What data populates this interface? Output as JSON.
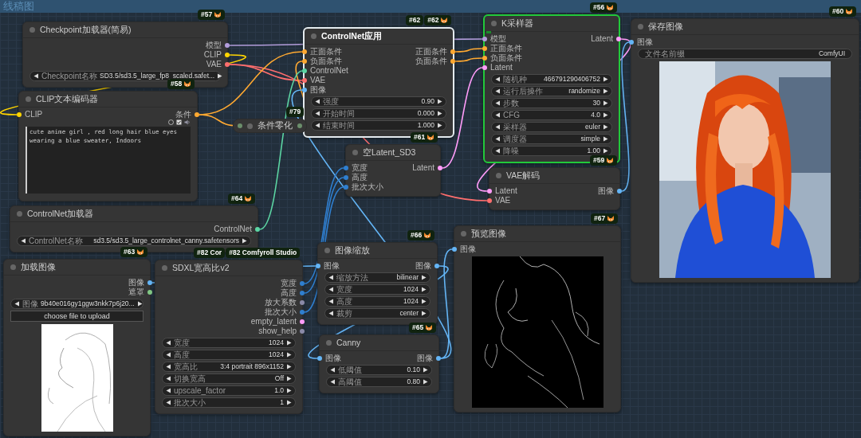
{
  "group": {
    "title": "线稿图"
  },
  "nodes": [
    {
      "kind": "node",
      "title": "Checkpoint加载器(简易)",
      "selected": false,
      "running": false,
      "badges": [
        {
          "text": "#57",
          "fox": true
        }
      ],
      "outputs": [
        {
          "label": "模型",
          "color": "#b39ddb"
        },
        {
          "label": "CLIP",
          "color": "#ffd500"
        },
        {
          "label": "VAE",
          "color": "#ff6e6e"
        }
      ],
      "widgets": [
        {
          "label": "Checkpoint名称",
          "value": "SD3.5/sd3.5_large_fp8_scaled.safet..."
        }
      ]
    },
    {
      "kind": "node",
      "title": "ControlNet应用",
      "selected": true,
      "running": false,
      "badges": [
        {
          "text": "#62",
          "fox": false
        },
        {
          "text": "#62",
          "fox": true
        }
      ],
      "inputs": [
        {
          "label": "正面条件",
          "color": "#ffa931"
        },
        {
          "label": "负面条件",
          "color": "#ffa931"
        },
        {
          "label": "ControlNet",
          "color": "#5cd6a4"
        },
        {
          "label": "VAE",
          "color": "#ff6e6e"
        },
        {
          "label": "图像",
          "color": "#64b5f6"
        }
      ],
      "outputs": [
        {
          "label": "正面条件",
          "color": "#ffa931"
        },
        {
          "label": "负面条件",
          "color": "#ffa931"
        }
      ],
      "widgets": [
        {
          "label": "强度",
          "value": "0.90"
        },
        {
          "label": "开始时间",
          "value": "0.000"
        },
        {
          "label": "结束时间",
          "value": "1.000"
        }
      ]
    },
    {
      "kind": "node",
      "title": "K采样器",
      "selected": false,
      "running": true,
      "badges": [
        {
          "text": "#56",
          "fox": true
        }
      ],
      "inputs": [
        {
          "label": "模型",
          "color": "#b39ddb"
        },
        {
          "label": "正面条件",
          "color": "#ffa931"
        },
        {
          "label": "负面条件",
          "color": "#ffa931"
        },
        {
          "label": "Latent",
          "color": "#ff9cf9"
        }
      ],
      "outputs": [
        {
          "label": "Latent",
          "color": "#ff9cf9"
        }
      ],
      "widgets": [
        {
          "label": "随机种",
          "value": "466791290406752"
        },
        {
          "label": "运行后操作",
          "value": "randomize"
        },
        {
          "label": "步数",
          "value": "30"
        },
        {
          "label": "CFG",
          "value": "4.0"
        },
        {
          "label": "采样器",
          "value": "euler"
        },
        {
          "label": "调度器",
          "value": "simple"
        },
        {
          "label": "降噪",
          "value": "1.00"
        }
      ]
    },
    {
      "kind": "node",
      "title": "保存图像",
      "selected": false,
      "running": false,
      "badges": [
        {
          "text": "#60",
          "fox": true
        }
      ],
      "inputs": [
        {
          "label": "图像",
          "color": "#64b5f6"
        }
      ],
      "text_widgets": [
        {
          "label": "文件名前缀",
          "value": "ComfyUI"
        }
      ],
      "image": {
        "kind": "picture"
      }
    },
    {
      "kind": "node",
      "title": "CLIP文本编码器",
      "selected": false,
      "running": false,
      "badges": [
        {
          "text": "#58",
          "fox": true
        }
      ],
      "inputs": [
        {
          "label": "CLIP",
          "color": "#ffd500"
        }
      ],
      "outputs": [
        {
          "label": "条件",
          "color": "#ffa931"
        }
      ],
      "prompt": "cute anime girl , red long hair blue eyes wearing a blue sweater, Indoors"
    },
    {
      "kind": "collapsed",
      "title": "条件零化",
      "selected": false,
      "running": false,
      "badges": [
        {
          "text": "#79",
          "fox": false
        }
      ]
    },
    {
      "kind": "node",
      "title": "空Latent_SD3",
      "selected": false,
      "running": false,
      "badges": [
        {
          "text": "#61",
          "fox": true
        }
      ],
      "inputs": [
        {
          "label": "宽度",
          "color": "#2f7fd0"
        },
        {
          "label": "高度",
          "color": "#2f7fd0"
        },
        {
          "label": "批次大小",
          "color": "#2f7fd0"
        }
      ],
      "outputs": [
        {
          "label": "Latent",
          "color": "#ff9cf9"
        }
      ]
    },
    {
      "kind": "node",
      "title": "VAE解码",
      "selected": false,
      "running": false,
      "badges": [
        {
          "text": "#59",
          "fox": true
        }
      ],
      "inputs": [
        {
          "label": "Latent",
          "color": "#ff9cf9"
        },
        {
          "label": "VAE",
          "color": "#ff6e6e"
        }
      ],
      "outputs": [
        {
          "label": "图像",
          "color": "#64b5f6"
        }
      ]
    },
    {
      "kind": "node",
      "title": "ControlNet加载器",
      "selected": false,
      "running": false,
      "badges": [
        {
          "text": "#64",
          "fox": true
        }
      ],
      "outputs": [
        {
          "label": "ControlNet",
          "color": "#5cd6a4"
        }
      ],
      "widgets": [
        {
          "label": "ControlNet名称",
          "value": "sd3.5/sd3.5_large_controlnet_canny.safetensors"
        }
      ]
    },
    {
      "kind": "node",
      "title": "加载图像",
      "selected": false,
      "running": false,
      "badges": [
        {
          "text": "#63",
          "fox": true
        }
      ],
      "outputs": [
        {
          "label": "图像",
          "color": "#64b5f6"
        },
        {
          "label": "遮罩",
          "color": "#81c784"
        }
      ],
      "widgets": [
        {
          "label": "图像",
          "value": "9b40e016gy1ggw3nkk7p6j20..."
        }
      ],
      "upload_button": "choose file to upload",
      "image": {
        "kind": "picture"
      }
    },
    {
      "kind": "node",
      "title": "SDXL宽高比v2",
      "selected": false,
      "running": false,
      "badges": [
        {
          "text": "#82 Cor",
          "fox": false
        },
        {
          "text": "#82 Comfyroll Studio",
          "fox": false
        }
      ],
      "outputs": [
        {
          "label": "宽度",
          "color": "#2f7fd0"
        },
        {
          "label": "高度",
          "color": "#2f7fd0"
        },
        {
          "label": "放大系数",
          "color": "#8a8aa8"
        },
        {
          "label": "批次大小",
          "color": "#2f7fd0"
        },
        {
          "label": "empty_latent",
          "color": "#ff9cf9"
        },
        {
          "label": "show_help",
          "color": "#8a8aa8"
        }
      ],
      "widgets": [
        {
          "label": "宽度",
          "value": "1024"
        },
        {
          "label": "高度",
          "value": "1024"
        },
        {
          "label": "宽高比",
          "value": "3:4 portrait 896x1152"
        },
        {
          "label": "切换宽高",
          "value": "Off"
        },
        {
          "label": "upscale_factor",
          "value": "1.0"
        },
        {
          "label": "批次大小",
          "value": "1"
        }
      ]
    },
    {
      "kind": "node",
      "title": "图像缩放",
      "selected": false,
      "running": false,
      "badges": [
        {
          "text": "#66",
          "fox": true
        }
      ],
      "inputs": [
        {
          "label": "图像",
          "color": "#64b5f6"
        }
      ],
      "outputs": [
        {
          "label": "图像",
          "color": "#64b5f6"
        }
      ],
      "widgets": [
        {
          "label": "缩放方法",
          "value": "bilinear"
        },
        {
          "label": "宽度",
          "value": "1024"
        },
        {
          "label": "高度",
          "value": "1024"
        },
        {
          "label": "裁剪",
          "value": "center"
        }
      ]
    },
    {
      "kind": "node",
      "title": "Canny",
      "selected": false,
      "running": false,
      "badges": [
        {
          "text": "#65",
          "fox": true
        }
      ],
      "inputs": [
        {
          "label": "图像",
          "color": "#64b5f6"
        }
      ],
      "outputs": [
        {
          "label": "图像",
          "color": "#64b5f6"
        }
      ],
      "widgets": [
        {
          "label": "低阈值",
          "value": "0.10"
        },
        {
          "label": "高阈值",
          "value": "0.80"
        }
      ]
    },
    {
      "kind": "node",
      "title": "预览图像",
      "selected": false,
      "running": false,
      "badges": [
        {
          "text": "#67",
          "fox": true
        }
      ],
      "inputs": [
        {
          "label": "图像",
          "color": "#64b5f6"
        }
      ],
      "image": {
        "kind": "picture"
      }
    }
  ]
}
